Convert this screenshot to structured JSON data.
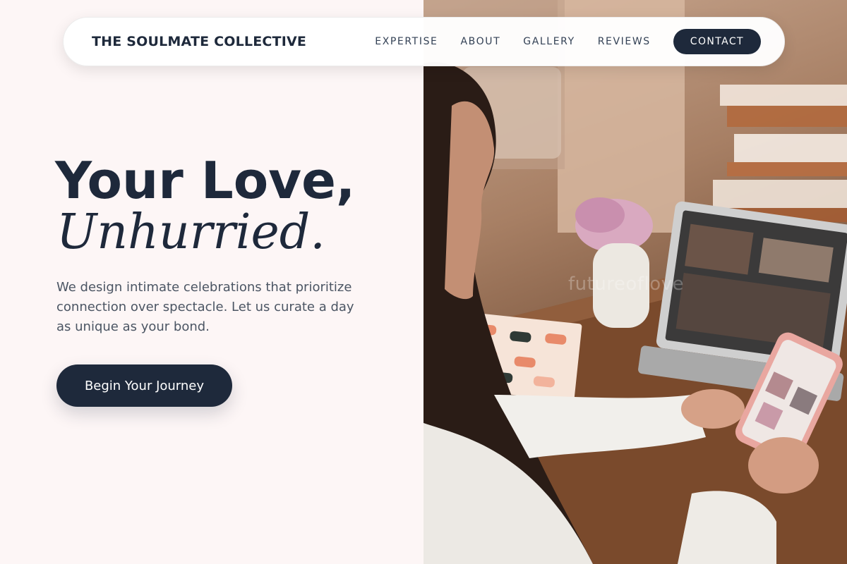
{
  "nav": {
    "brand": "THE SOULMATE COLLECTIVE",
    "items": [
      {
        "label": "EXPERTISE"
      },
      {
        "label": "ABOUT"
      },
      {
        "label": "GALLERY"
      },
      {
        "label": "REVIEWS"
      }
    ],
    "contact_label": "CONTACT"
  },
  "hero": {
    "title_line1": "Your Love,",
    "title_line2": "Unhurried.",
    "description": "We design intimate celebrations that prioritize connection over spectacle. Let us curate a day as unique as your bond.",
    "cta_label": "Begin Your Journey"
  },
  "photo": {
    "watermark": "futureoflove"
  },
  "colors": {
    "background": "#fdf6f6",
    "primary": "#1e293b",
    "body_text": "#4b5563"
  }
}
